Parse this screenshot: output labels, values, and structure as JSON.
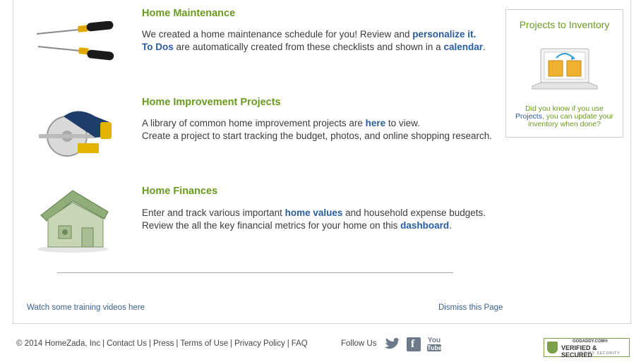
{
  "sections": [
    {
      "title": "Home Maintenance",
      "line1_pre": "We created a home maintenance schedule for you! Review and ",
      "line1_link": "personalize it.",
      "line2_link": "To Dos",
      "line2_mid": " are automatically created from these checklists and shown in a ",
      "line2_link2": "calendar",
      "line2_end": "."
    },
    {
      "title": "Home Improvement Projects",
      "line1_pre": "A library of common home improvement projects are ",
      "line1_link": "here",
      "line1_end": " to view.",
      "line2": "Create a project to start tracking the budget, photos, and online shopping research."
    },
    {
      "title": "Home Finances",
      "line1_pre": "Enter and track various important ",
      "line1_link": "home values",
      "line1_end": " and household expense budgets.",
      "line2_pre": "Review the all the key financial metrics for your home on this ",
      "line2_link": "dashboard",
      "line2_end": "."
    }
  ],
  "sidebar": {
    "title": "Projects to Inventory",
    "text_pre": "Did you know if you use ",
    "text_link": "Projects",
    "text_end": ", you can update your inventory when done?"
  },
  "bottom_links": {
    "training": "Watch some training videos here",
    "dismiss": "Dismiss this Page"
  },
  "footer": {
    "copyright": "© 2014 HomeZada, Inc",
    "links": [
      "Contact Us",
      "Press",
      "Terms of Use",
      "Privacy Policy",
      "FAQ"
    ],
    "follow": "Follow Us",
    "social_icons": [
      "twitter-icon",
      "facebook-icon",
      "youtube-icon"
    ],
    "youtube_top": "You",
    "youtube_bottom": "Tube",
    "facebook_letter": "f",
    "badge_top": "GODADDY.COM®",
    "badge_main": "VERIFIED & SECURED",
    "badge_sub": "VERIFY SECURITY"
  },
  "colors": {
    "accent_green": "#6a9a1f",
    "link_blue": "#2a5d9f"
  }
}
